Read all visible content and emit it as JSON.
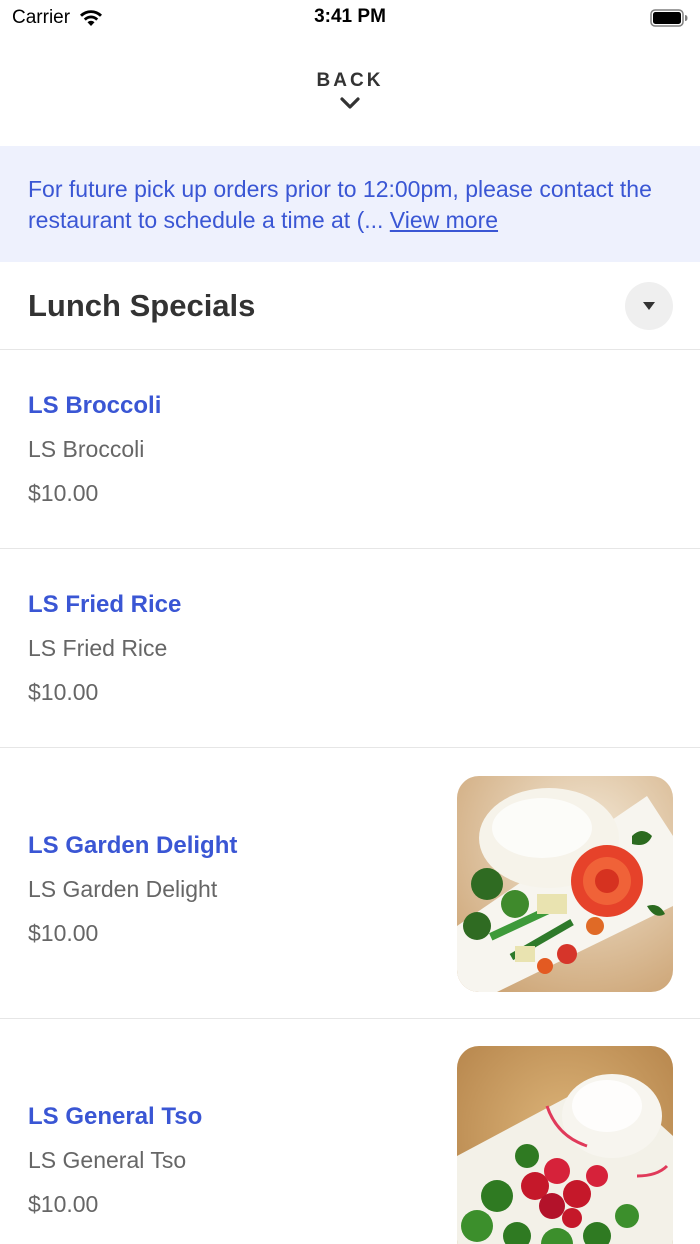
{
  "status_bar": {
    "carrier": "Carrier",
    "time": "3:41 PM",
    "wifi_icon": "wifi-icon",
    "battery_icon": "battery-icon"
  },
  "nav": {
    "back_label": "BACK",
    "back_icon": "chevron-down-icon"
  },
  "notice": {
    "text": "For future pick up orders prior to 12:00pm, please contact the restaurant to schedule a time at (...",
    "more_label": "View more"
  },
  "section": {
    "title": "Lunch Specials",
    "toggle_icon": "caret-down-icon"
  },
  "items": [
    {
      "name": "LS Broccoli",
      "description": "LS Broccoli",
      "price": "$10.00"
    },
    {
      "name": "LS Fried Rice",
      "description": "LS Fried Rice",
      "price": "$10.00"
    },
    {
      "name": "LS Garden Delight",
      "description": "LS Garden Delight",
      "price": "$10.00",
      "photo_icon": "food-photo-garden-delight"
    },
    {
      "name": "LS General Tso",
      "description": "LS General Tso",
      "price": "$10.00",
      "photo_icon": "food-photo-general-tso"
    }
  ],
  "colors": {
    "accent": "#3a56d4",
    "banner_bg": "#eef1fd",
    "divider": "#e6e6e6"
  }
}
